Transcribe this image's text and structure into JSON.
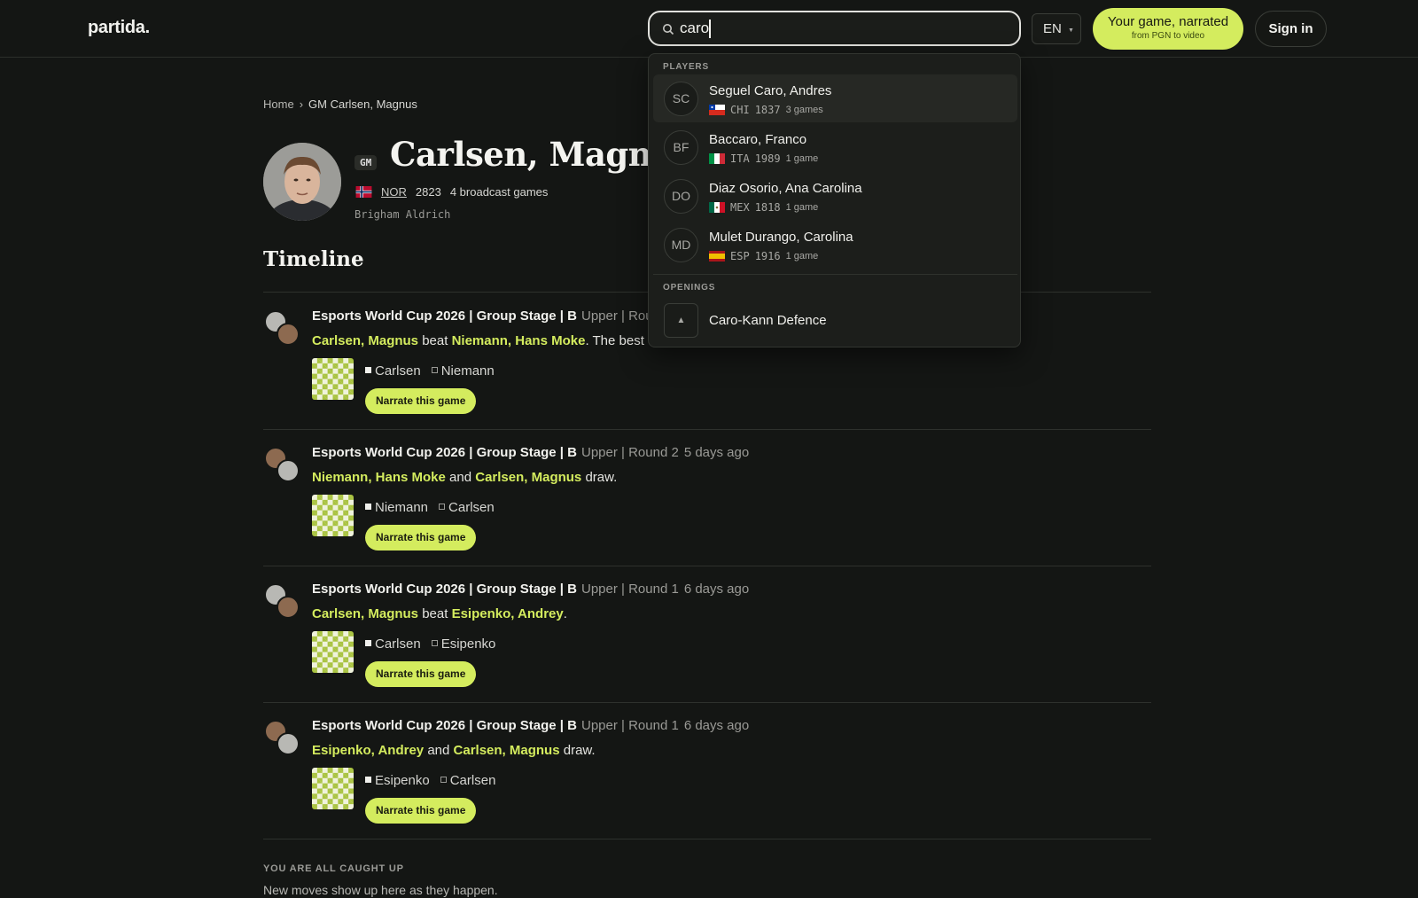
{
  "header": {
    "logo": "partida.",
    "search_value": "caro",
    "lang": "EN",
    "cta_title": "Your game, narrated",
    "cta_sub": "from PGN to video",
    "signin": "Sign in"
  },
  "breadcrumb": {
    "home": "Home",
    "sep": "›",
    "current": "GM Carlsen, Magnus"
  },
  "player": {
    "title": "GM",
    "name": "Carlsen, Magnus",
    "fed": "NOR",
    "rating": "2823",
    "games_count": "4",
    "games_label": "broadcast games",
    "sub": "Brigham Aldrich"
  },
  "timeline": {
    "heading": "Timeline",
    "entries": [
      {
        "event": "Esports World Cup 2026 | Group Stage | B",
        "round": "Upper | Round 2",
        "ago": "",
        "p1": "Carlsen, Magnus",
        "verb": "beat",
        "p2": "Niemann, Hans Moke",
        "tail": ". The best w",
        "white": "Carlsen",
        "black": "Niemann",
        "narrate": "Narrate this game"
      },
      {
        "event": "Esports World Cup 2026 | Group Stage | B",
        "round": "Upper | Round 2",
        "ago": "5 days ago",
        "p1": "Niemann, Hans Moke",
        "verb": "and",
        "p2": "Carlsen, Magnus",
        "tail": " draw.",
        "white": "Niemann",
        "black": "Carlsen",
        "narrate": "Narrate this game"
      },
      {
        "event": "Esports World Cup 2026 | Group Stage | B",
        "round": "Upper | Round 1",
        "ago": "6 days ago",
        "p1": "Carlsen, Magnus",
        "verb": "beat",
        "p2": "Esipenko, Andrey",
        "tail": ".",
        "white": "Carlsen",
        "black": "Esipenko",
        "narrate": "Narrate this game"
      },
      {
        "event": "Esports World Cup 2026 | Group Stage | B",
        "round": "Upper | Round 1",
        "ago": "6 days ago",
        "p1": "Esipenko, Andrey",
        "verb": "and",
        "p2": "Carlsen, Magnus",
        "tail": " draw.",
        "white": "Esipenko",
        "black": "Carlsen",
        "narrate": "Narrate this game"
      }
    ],
    "caught_up_heading": "YOU ARE ALL CAUGHT UP",
    "caught_up_sub": "New moves show up here as they happen."
  },
  "search_dropdown": {
    "players_label": "PLAYERS",
    "players": [
      {
        "initials": "SC",
        "name": "Seguel Caro, Andres",
        "fed": "CHI",
        "rating": "1837",
        "games": "3 games"
      },
      {
        "initials": "BF",
        "name": "Baccaro, Franco",
        "fed": "ITA",
        "rating": "1989",
        "games": "1 game"
      },
      {
        "initials": "DO",
        "name": "Diaz Osorio, Ana Carolina",
        "fed": "MEX",
        "rating": "1818",
        "games": "1 game"
      },
      {
        "initials": "MD",
        "name": "Mulet Durango, Carolina",
        "fed": "ESP",
        "rating": "1916",
        "games": "1 game"
      }
    ],
    "openings_label": "OPENINGS",
    "openings": [
      {
        "icon": "▲",
        "name": "Caro-Kann Defence"
      }
    ]
  },
  "colors": {
    "accent": "#d4ec5e",
    "background": "#141614"
  }
}
